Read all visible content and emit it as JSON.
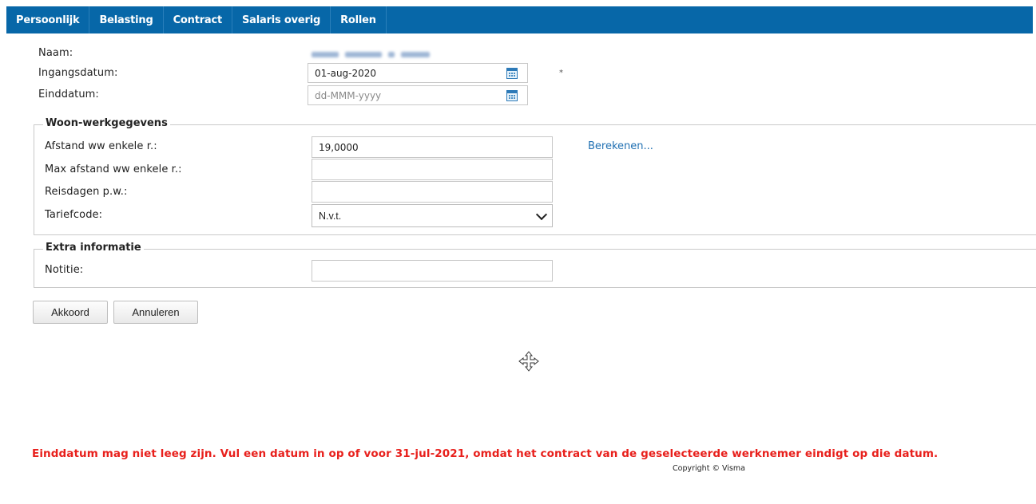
{
  "tabs": [
    "Persoonlijk",
    "Belasting",
    "Contract",
    "Salaris overig",
    "Rollen"
  ],
  "form": {
    "naam_label": "Naam:",
    "ingangsdatum_label": "Ingangsdatum:",
    "ingangsdatum_value": "01-aug-2020",
    "required_marker": "*",
    "einddatum_label": "Einddatum:",
    "einddatum_placeholder": "dd-MMM-yyyy"
  },
  "woon_werk": {
    "legend": "Woon-werkgegevens",
    "afstand_label": "Afstand ww enkele r.:",
    "afstand_value": "19,0000",
    "berekenen_link": "Berekenen...",
    "max_afstand_label": "Max afstand ww enkele r.:",
    "max_afstand_value": "",
    "reisdagen_label": "Reisdagen p.w.:",
    "reisdagen_value": "",
    "tariefcode_label": "Tariefcode:",
    "tariefcode_value": "N.v.t."
  },
  "extra": {
    "legend": "Extra informatie",
    "notitie_label": "Notitie:",
    "notitie_value": ""
  },
  "buttons": {
    "akkoord": "Akkoord",
    "annuleren": "Annuleren"
  },
  "messages": {
    "error": "Einddatum mag niet leeg zijn. Vul een datum in op of voor 31-jul-2021, omdat het contract van de geselecteerde werknemer eindigt op die datum.",
    "copyright": "Copyright © Visma"
  },
  "colors": {
    "tabbar": "#0767a8",
    "link": "#1f6fb2",
    "error": "#e8201c"
  },
  "icons": {
    "calendar": "calendar-icon",
    "move_cursor": "move-cursor-icon",
    "select_caret": "chevron-down-icon"
  }
}
